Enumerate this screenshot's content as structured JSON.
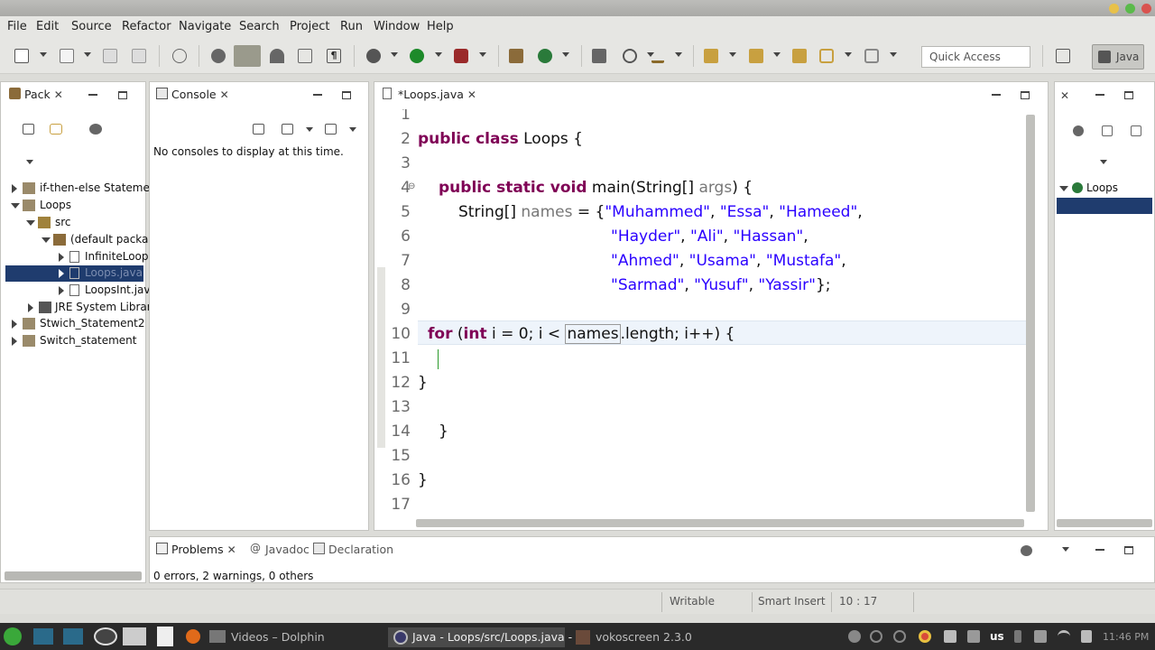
{
  "menu": [
    "File",
    "Edit",
    "Source",
    "Refactor",
    "Navigate",
    "Search",
    "Project",
    "Run",
    "Window",
    "Help"
  ],
  "toolbar": {
    "quick_access": "Quick Access",
    "perspective": "Java"
  },
  "package_explorer": {
    "tab": "Pack",
    "tree": [
      {
        "label": "if-then-else Stateme",
        "expanded": false
      },
      {
        "label": "Loops",
        "expanded": true
      },
      {
        "label": "src",
        "expanded": true
      },
      {
        "label": "(default packa",
        "expanded": true
      },
      {
        "label": "InfiniteLoop",
        "expanded": false
      },
      {
        "label": "Loops.java",
        "expanded": false,
        "selected": true
      },
      {
        "label": "LoopsInt.jav",
        "expanded": false
      },
      {
        "label": "JRE System Librar",
        "expanded": false
      },
      {
        "label": "Stwich_Statement2",
        "expanded": false
      },
      {
        "label": "Switch_statement",
        "expanded": false
      }
    ]
  },
  "console": {
    "tab": "Console",
    "message": "No consoles to display at this time."
  },
  "editor": {
    "tab": "*Loops.java",
    "line_numbers": [
      "1",
      "2",
      "3",
      "4",
      "5",
      "6",
      "7",
      "8",
      "9",
      "10",
      "11",
      "12",
      "13",
      "14",
      "15",
      "16",
      "17"
    ],
    "lines": {
      "l2": {
        "kw": "public class",
        "rest": " Loops {"
      },
      "l4": {
        "kw": "public static void",
        "rest": " main(String[] ",
        "var": "args",
        "end": ") {"
      },
      "l5": {
        "a": "String[] ",
        "var": "names",
        "b": " = {",
        "s1": "\"Muhammed\"",
        "c1": ", ",
        "s2": "\"Essa\"",
        "c2": ", ",
        "s3": "\"Hameed\"",
        "c3": ","
      },
      "l6": {
        "s1": "\"Hayder\"",
        "c1": ", ",
        "s2": "\"Ali\"",
        "c2": ", ",
        "s3": "\"Hassan\"",
        "c3": ","
      },
      "l7": {
        "s1": "\"Ahmed\"",
        "c1": ", ",
        "s2": "\"Usama\"",
        "c2": ", ",
        "s3": "\"Mustafa\"",
        "c3": ","
      },
      "l8": {
        "s1": "\"Sarmad\"",
        "c1": ", ",
        "s2": "\"Yusuf\"",
        "c2": ", ",
        "s3": "\"Yassir\"",
        "c3": "};"
      },
      "l10": {
        "kw1": "for",
        "p": " (",
        "kw2": "int",
        "a": " i = 0; i < ",
        "names": "names",
        "b": ".length; i++) {"
      },
      "l12": "}",
      "l14": "}",
      "l16": "}"
    }
  },
  "outline": {
    "class_name": "Loops"
  },
  "bottom_tabs": {
    "problems": "Problems",
    "javadoc": "Javadoc",
    "declaration": "Declaration"
  },
  "problems_summary": "0 errors, 2 warnings, 0 others",
  "status": {
    "writable": "Writable",
    "insert_mode": "Smart Insert",
    "position": "10 : 17"
  },
  "taskbar": {
    "dolphin": "Videos – Dolphin",
    "eclipse": "Java - Loops/src/Loops.java -",
    "vokoscreen": "vokoscreen 2.3.0",
    "keyboard": "us",
    "clock": "11:46 PM"
  },
  "colors": {
    "keyword": "#7f0055",
    "string": "#2a00ff",
    "selection": "#1f3c6e"
  }
}
